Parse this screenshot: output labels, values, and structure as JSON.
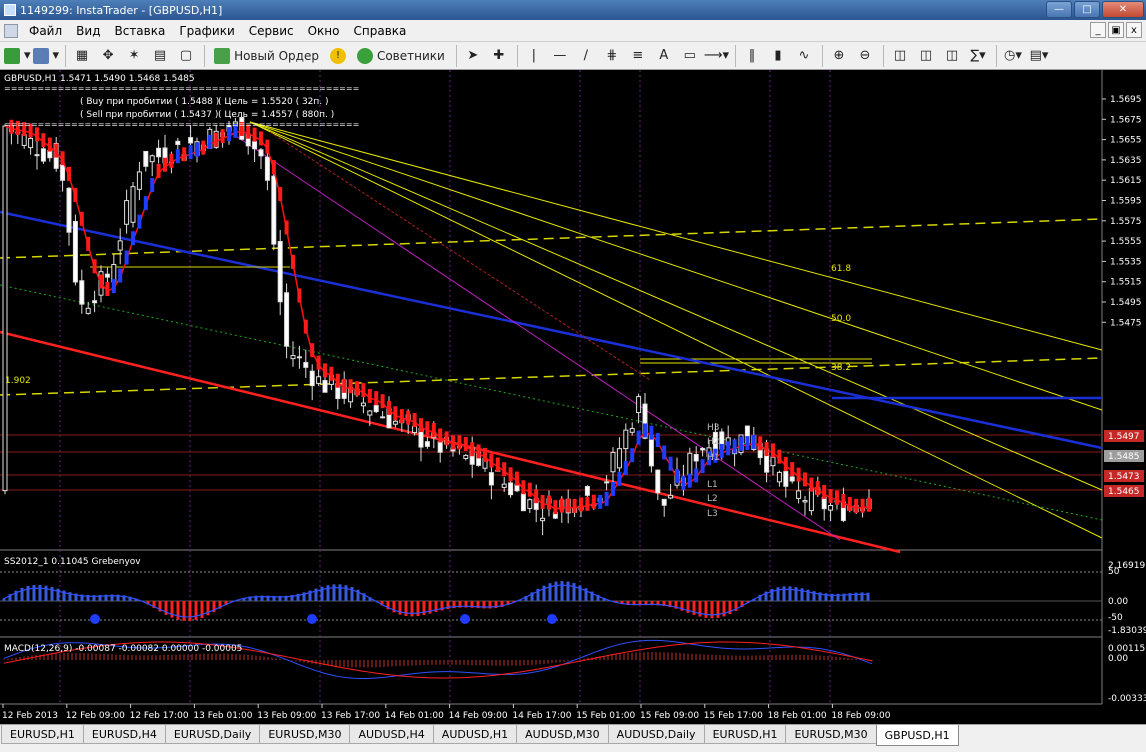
{
  "window": {
    "title": "1149299: InstaTrader - [GBPUSD,H1]"
  },
  "menu": {
    "items": [
      "Файл",
      "Вид",
      "Вставка",
      "Графики",
      "Сервис",
      "Окно",
      "Справка"
    ]
  },
  "toolbar": {
    "new_order": "Новый Ордер",
    "advisors": "Советники"
  },
  "chart": {
    "header": "GBPUSD,H1  1.5471 1.5490 1.5468 1.5485",
    "separator": "=====================================================",
    "buy_signal": "( Buy при пробитии ( 1.5488 )",
    "buy_target": "( Цель = 1.5520 ( 32п. )",
    "sell_signal": "( Sell  при пробитии ( 1.5437 )",
    "sell_target": "( Цель = 1.4557 ( 880п. )",
    "left_value": "1.902",
    "fib_labels": [
      "61.8",
      "50.0",
      "38.2"
    ],
    "pivot_labels": [
      "H3",
      "H2",
      "H1",
      "L1",
      "L2",
      "L3"
    ],
    "price_axis": [
      "1.5695",
      "1.5675",
      "1.5655",
      "1.5635",
      "1.5615",
      "1.5595",
      "1.5575",
      "1.5555",
      "1.5535",
      "1.5515",
      "1.5495",
      "1.5475"
    ],
    "price_tags": [
      {
        "value": "1.5497",
        "color": "#c62828"
      },
      {
        "value": "1.5485",
        "color": "#9e9e9e"
      },
      {
        "value": "1.5473",
        "color": "#c62828"
      },
      {
        "value": "1.5465",
        "color": "#c62828"
      }
    ],
    "time_axis": [
      "12 Feb 2013",
      "12 Feb 09:00",
      "12 Feb 17:00",
      "13 Feb 01:00",
      "13 Feb 09:00",
      "13 Feb 17:00",
      "14 Feb 01:00",
      "14 Feb 09:00",
      "14 Feb 17:00",
      "15 Feb 01:00",
      "15 Feb 09:00",
      "15 Feb 17:00",
      "18 Feb 01:00",
      "18 Feb 09:00"
    ]
  },
  "ss_panel": {
    "label": "SS2012_1 0.11045  Grebenyov",
    "axis": [
      "2.16919",
      "50",
      "0.00",
      "-50",
      "-1.83039"
    ]
  },
  "macd_panel": {
    "label": "MACD(12,26,9) -0.00087 -0.00082 0.00000 -0.00005",
    "axis": [
      "0.00115",
      "0.00",
      "-0.00333"
    ]
  },
  "tabs": [
    "EURUSD,H1",
    "EURUSD,H4",
    "EURUSD,Daily",
    "EURUSD,M30",
    "AUDUSD,H4",
    "AUDUSD,H1",
    "AUDUSD,M30",
    "AUDUSD,Daily",
    "EURUSD,H1",
    "EURUSD,M30",
    "GBPUSD,H1"
  ],
  "active_tab": "GBPUSD,H1"
}
